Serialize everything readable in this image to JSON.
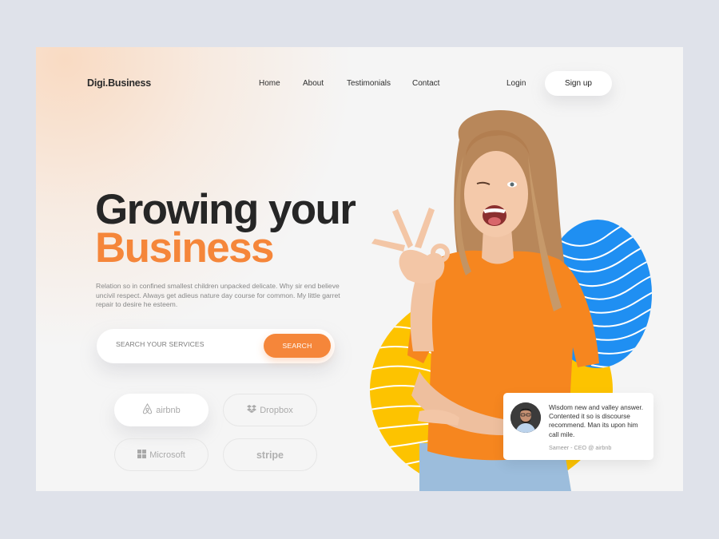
{
  "header": {
    "logo": "Digi.Business",
    "nav": [
      {
        "label": "Home"
      },
      {
        "label": "About"
      },
      {
        "label": "Testimonials"
      },
      {
        "label": "Contact"
      }
    ],
    "login_label": "Login",
    "signup_label": "Sign up"
  },
  "hero": {
    "title_line1": "Growing your",
    "title_line2": "Business",
    "description": "Relation so in confined smallest children unpacked delicate. Why sir end believe uncivil respect. Always get adieus nature day course for common. My little garret repair to desire he esteem.",
    "search": {
      "placeholder": "SEARCH YOUR SERVICES",
      "value": "",
      "button_label": "SEARCH"
    }
  },
  "brands": [
    {
      "name": "airbnb",
      "icon": "airbnb-icon",
      "active": true
    },
    {
      "name": "Dropbox",
      "icon": "dropbox-icon",
      "active": false
    },
    {
      "name": "Microsoft",
      "icon": "microsoft-icon",
      "active": false
    },
    {
      "name": "stripe",
      "icon": "",
      "active": false
    }
  ],
  "testimonial": {
    "quote": "Wisdom new and valley answer. Contented it so is discourse recommend. Man its upon him call mile.",
    "author": "Sameer - CEO @ airbnb"
  },
  "colors": {
    "accent": "#f5863a",
    "blue_circle": "#1f8ff2",
    "yellow_circle": "#fdc300",
    "page_bg": "#f5f5f5",
    "outer_bg": "#dfe2ea"
  }
}
